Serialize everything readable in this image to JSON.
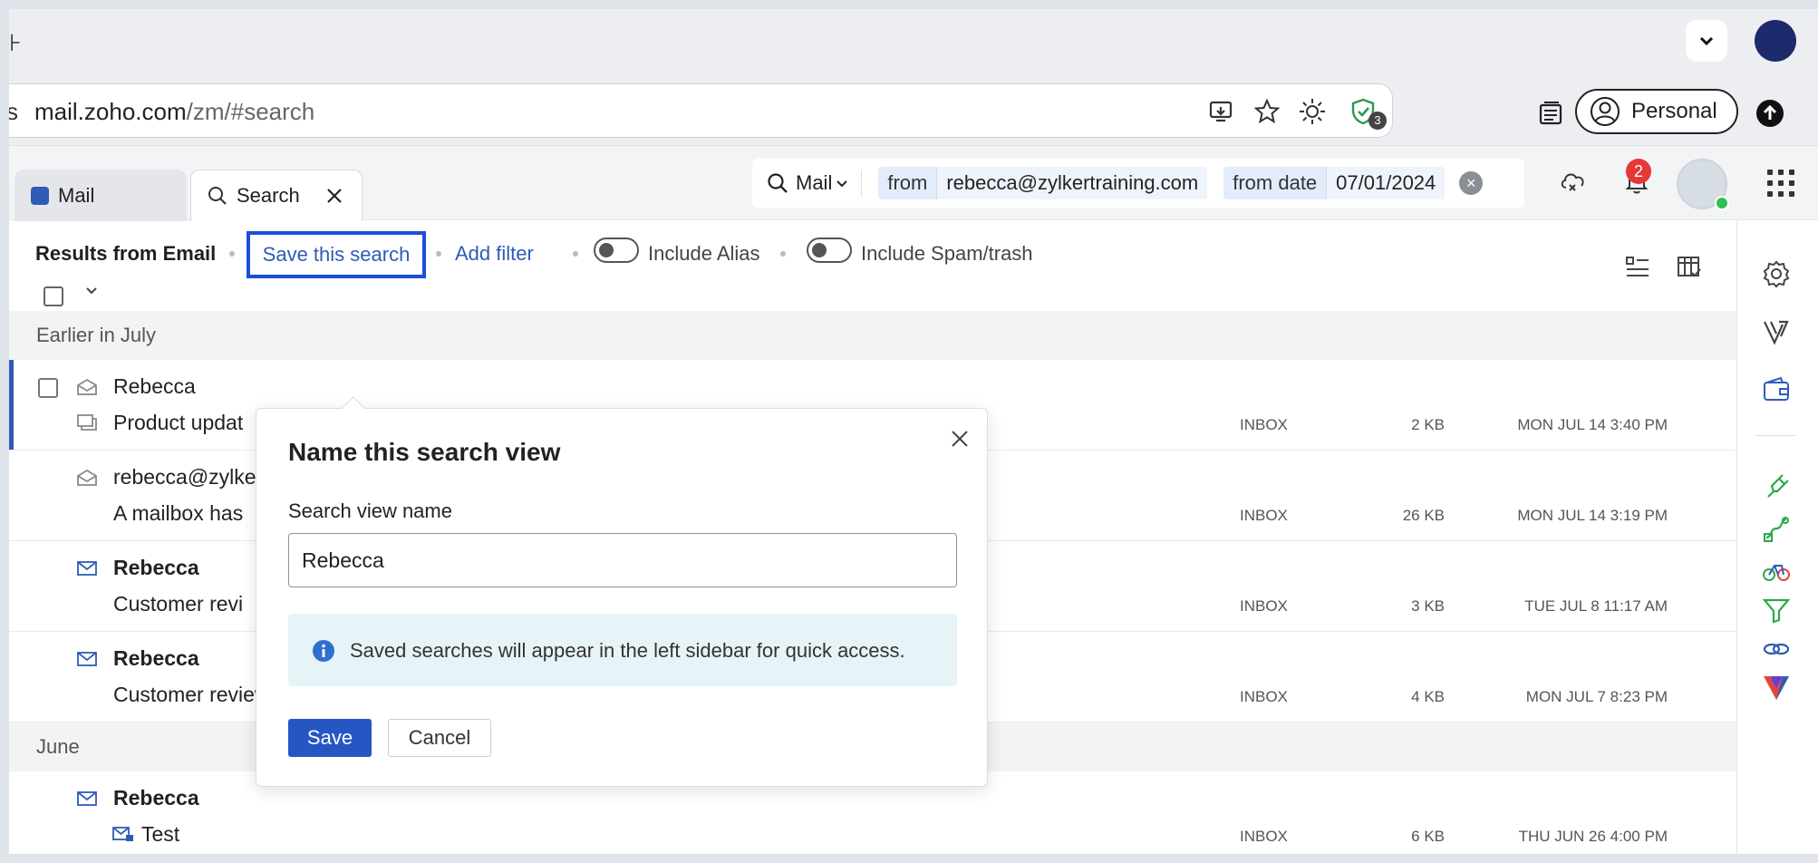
{
  "browser": {
    "tab_fragment": "⊦",
    "addr_prefix": "s",
    "url_host": "mail.zoho.com",
    "url_path": "/zm/#search",
    "extension_badge": "3",
    "profile_label": "Personal"
  },
  "tabs": [
    {
      "label": "Mail"
    },
    {
      "label": "Search"
    }
  ],
  "search": {
    "scope": "Mail",
    "chips": [
      {
        "key": "from",
        "value": "rebecca@zylkertraining.com"
      },
      {
        "key": "from date",
        "value": "07/01/2024"
      }
    ],
    "clear_glyph": "×"
  },
  "header": {
    "notification_count": "2"
  },
  "filters": {
    "results_label": "Results from Email",
    "save_search": "Save this search",
    "add_filter": "Add filter",
    "include_alias": "Include Alias",
    "include_spam": "Include Spam/trash"
  },
  "groups": [
    {
      "title": "Earlier in July",
      "rows": [
        {
          "sender": "Rebecca",
          "subject": "Product updat",
          "folder": "INBOX",
          "size": "2 KB",
          "date": "MON JUL 14 3:40 PM"
        },
        {
          "sender": "rebecca@zylke",
          "subject": "A mailbox has",
          "folder": "INBOX",
          "size": "26 KB",
          "date": "MON JUL 14 3:19 PM"
        },
        {
          "sender": "Rebecca",
          "subject": "Customer revi",
          "folder": "INBOX",
          "size": "3 KB",
          "date": "TUE JUL 8 11:17 AM"
        },
        {
          "sender": "Rebecca",
          "subject": "Customer review",
          "folder": "INBOX",
          "size": "4 KB",
          "date": "MON JUL 7 8:23 PM"
        }
      ]
    },
    {
      "title": "June",
      "rows": [
        {
          "sender": "Rebecca",
          "subject": "Test",
          "folder": "INBOX",
          "size": "6 KB",
          "date": "THU JUN 26 4:00 PM"
        }
      ]
    }
  ],
  "dialog": {
    "title": "Name this search view",
    "field_label": "Search view name",
    "field_value": "Rebecca",
    "info": "Saved searches will appear in the left sidebar for quick access.",
    "save": "Save",
    "cancel": "Cancel"
  },
  "colors": {
    "accent": "#2557c4",
    "link": "#2f5bb7",
    "focus_outline": "#1c4ed8",
    "info_bg": "#e6f3f7",
    "badge_red": "#e53935"
  },
  "icons": [
    "chevron-down-icon",
    "cast-icon",
    "star-icon",
    "brightness-icon",
    "shield-check-icon",
    "reading-list-icon",
    "profile-icon",
    "upload-icon",
    "search-icon",
    "close-icon",
    "cloud-sync-icon",
    "bell-icon",
    "apps-grid-icon",
    "envelope-icon",
    "list-view-icon",
    "column-view-icon",
    "gear-icon",
    "v-logo-icon",
    "wallet-icon",
    "plug-icon",
    "route-icon",
    "bike-icon",
    "funnel-icon",
    "link-icon",
    "info-icon"
  ]
}
